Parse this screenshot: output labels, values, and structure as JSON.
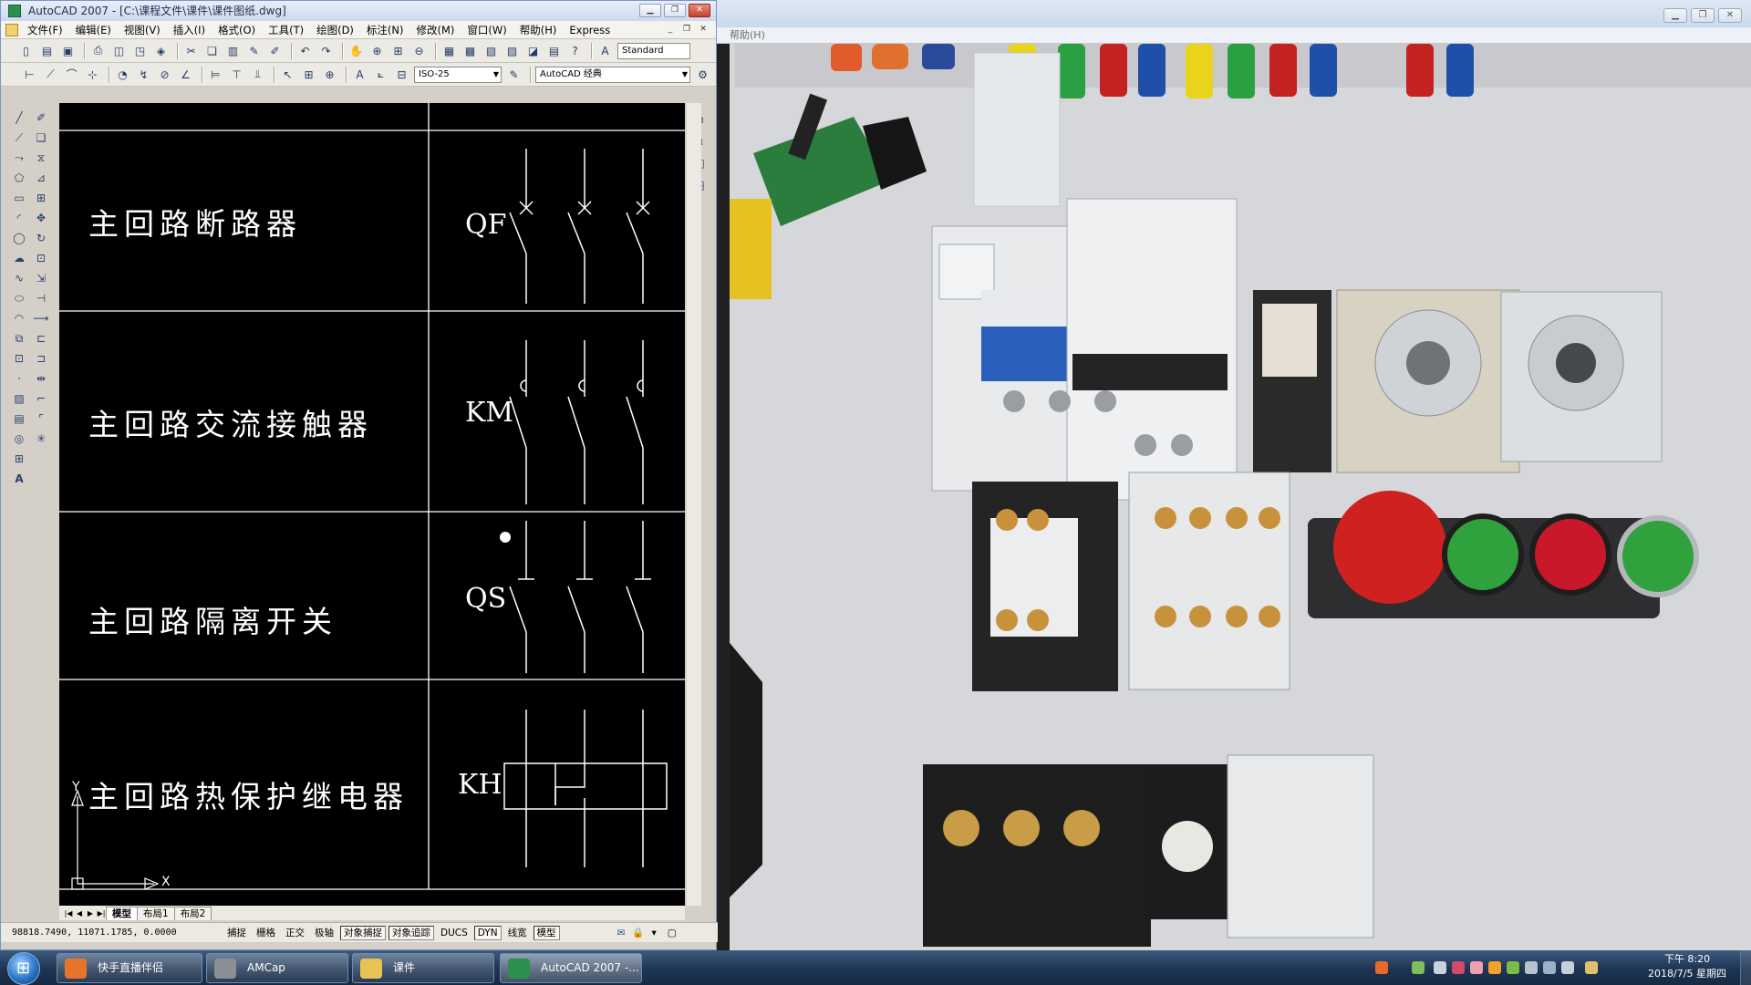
{
  "acad": {
    "title": "AutoCAD 2007 - [C:\\课程文件\\课件\\课件图纸.dwg]",
    "menu": [
      "文件(F)",
      "编辑(E)",
      "视图(V)",
      "插入(I)",
      "格式(O)",
      "工具(T)",
      "绘图(D)",
      "标注(N)",
      "修改(M)",
      "窗口(W)",
      "帮助(H)",
      "Express"
    ],
    "text_style": "Standard",
    "dim_style": "ISO-25",
    "workspace": "AutoCAD 经典",
    "rows": [
      {
        "label": "主回路断路器",
        "code": "QF"
      },
      {
        "label": "主回路交流接触器",
        "code": "KM"
      },
      {
        "label": "主回路隔离开关",
        "code": "QS"
      },
      {
        "label": "主回路热保护继电器",
        "code": "KH"
      }
    ],
    "ucs": {
      "x": "X",
      "y": "Y"
    },
    "tabs": [
      "模型",
      "布局1",
      "布局2"
    ],
    "coords": "98818.7490, 11071.1785, 0.0000",
    "status_buttons": [
      "捕捉",
      "栅格",
      "正交",
      "极轴",
      "对象捕捉",
      "对象追踪",
      "DUCS",
      "DYN",
      "线宽",
      "模型"
    ]
  },
  "camera": {
    "menu_help": "帮助(H)"
  },
  "taskbar": {
    "items": [
      {
        "label": "快手直播伴侣",
        "color": "#e8742b"
      },
      {
        "label": "AMCap",
        "color": "#8a8f96"
      },
      {
        "label": "课件",
        "color": "#e9c454"
      },
      {
        "label": "AutoCAD 2007 -...",
        "color": "#2b8f4f"
      }
    ],
    "clock_time": "下午 8:20",
    "clock_date": "2018/7/5 星期四"
  }
}
